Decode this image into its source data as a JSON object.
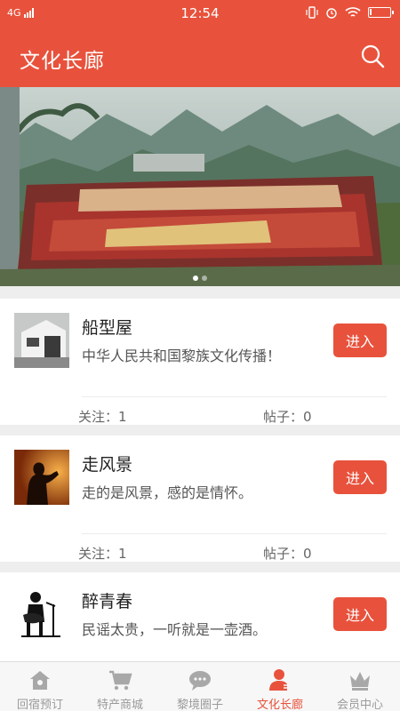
{
  "status_bar": {
    "network": "4G",
    "time": "12:54"
  },
  "header": {
    "title": "文化长廊"
  },
  "banner": {
    "slide_count": 2,
    "active_slide": 1
  },
  "cards": [
    {
      "title": "船型屋",
      "description": "中华人民共和国黎族文化传播！",
      "enter_label": "进入",
      "follow_label": "关注：1",
      "posts_label": "帖子：0"
    },
    {
      "title": "走风景",
      "description": "走的是风景，感的是情怀。",
      "enter_label": "进入",
      "follow_label": "关注：1",
      "posts_label": "帖子：0"
    },
    {
      "title": "醉青春",
      "description": "民谣太贵，一听就是一壶酒。",
      "enter_label": "进入"
    }
  ],
  "tabbar": {
    "tabs": [
      {
        "label": "回宿预订",
        "icon": "house-icon"
      },
      {
        "label": "特产商城",
        "icon": "cart-icon"
      },
      {
        "label": "黎境圈子",
        "icon": "chat-icon"
      },
      {
        "label": "文化长廊",
        "icon": "person-icon"
      },
      {
        "label": "会员中心",
        "icon": "crown-icon"
      }
    ],
    "active_index": 3
  },
  "colors": {
    "accent": "#e8523c",
    "tab_inactive": "#9a9a9a"
  }
}
